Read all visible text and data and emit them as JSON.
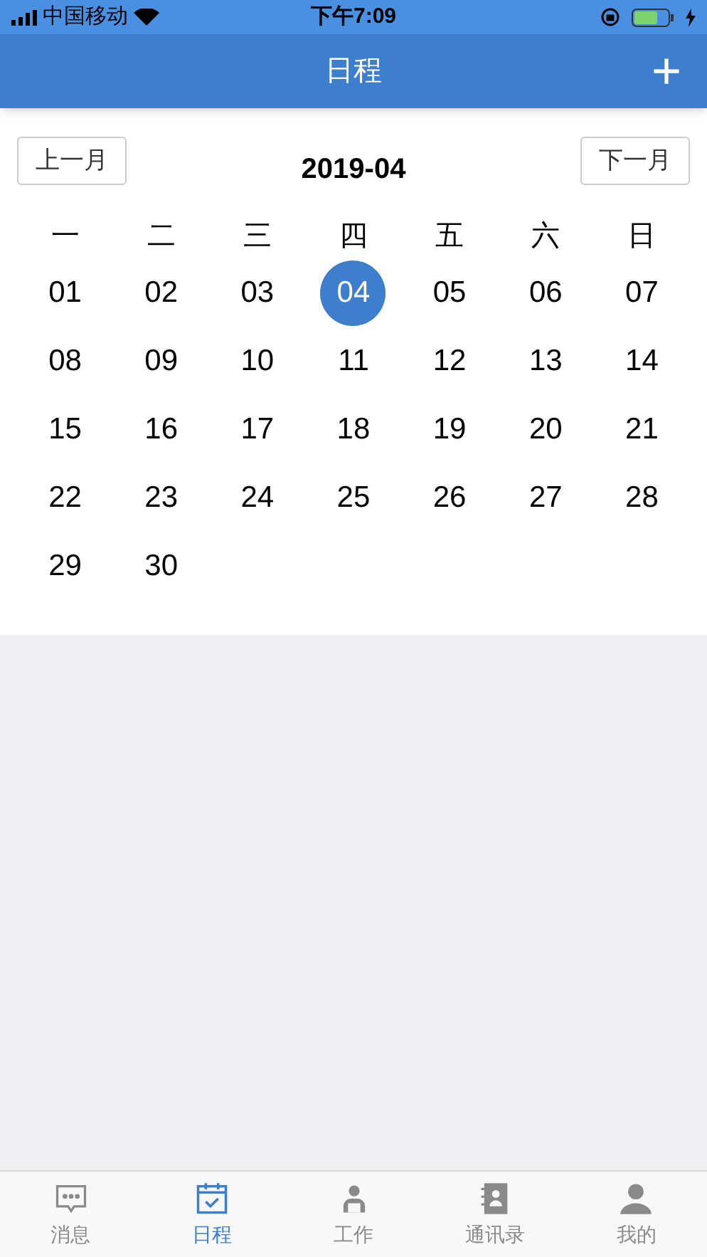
{
  "status_bar": {
    "carrier": "中国移动",
    "time": "下午7:09"
  },
  "header": {
    "title": "日程",
    "add_button": "+"
  },
  "calendar": {
    "prev_button": "上一月",
    "month": "2019-04",
    "next_button": "下一月",
    "weekdays": [
      "一",
      "二",
      "三",
      "四",
      "五",
      "六",
      "日"
    ],
    "days": [
      {
        "label": "01",
        "selected": false
      },
      {
        "label": "02",
        "selected": false
      },
      {
        "label": "03",
        "selected": false
      },
      {
        "label": "04",
        "selected": true
      },
      {
        "label": "05",
        "selected": false
      },
      {
        "label": "06",
        "selected": false
      },
      {
        "label": "07",
        "selected": false
      },
      {
        "label": "08",
        "selected": false
      },
      {
        "label": "09",
        "selected": false
      },
      {
        "label": "10",
        "selected": false
      },
      {
        "label": "11",
        "selected": false
      },
      {
        "label": "12",
        "selected": false
      },
      {
        "label": "13",
        "selected": false
      },
      {
        "label": "14",
        "selected": false
      },
      {
        "label": "15",
        "selected": false
      },
      {
        "label": "16",
        "selected": false
      },
      {
        "label": "17",
        "selected": false
      },
      {
        "label": "18",
        "selected": false
      },
      {
        "label": "19",
        "selected": false
      },
      {
        "label": "20",
        "selected": false
      },
      {
        "label": "21",
        "selected": false
      },
      {
        "label": "22",
        "selected": false
      },
      {
        "label": "23",
        "selected": false
      },
      {
        "label": "24",
        "selected": false
      },
      {
        "label": "25",
        "selected": false
      },
      {
        "label": "26",
        "selected": false
      },
      {
        "label": "27",
        "selected": false
      },
      {
        "label": "28",
        "selected": false
      },
      {
        "label": "29",
        "selected": false
      },
      {
        "label": "30",
        "selected": false
      }
    ]
  },
  "tab_bar": [
    {
      "label": "消息",
      "kind": "message",
      "selected": false
    },
    {
      "label": "日程",
      "kind": "calendar",
      "selected": true
    },
    {
      "label": "工作",
      "kind": "work",
      "selected": false
    },
    {
      "label": "通讯录",
      "kind": "contacts",
      "selected": false
    },
    {
      "label": "我的",
      "kind": "profile",
      "selected": false
    }
  ]
}
